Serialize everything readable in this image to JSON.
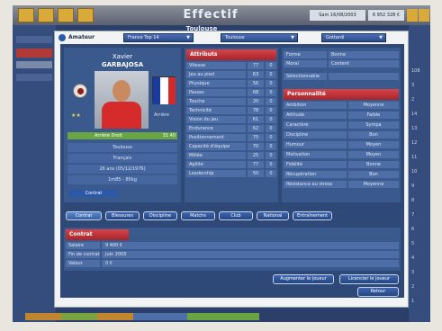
{
  "screen": {
    "title": "Effectif",
    "team_subtitle": "Toulouse",
    "date": "Sam 16/08/2003",
    "money": "6 952 328 €"
  },
  "dialog_header": {
    "logo": "Amateur",
    "filter_1": "France Top 14",
    "filter_2": "Toulouse",
    "filter_3": "Gottardi"
  },
  "player": {
    "first_name": "Xavier",
    "last_name": "GARBAJOSA",
    "stars": "★★",
    "side": "Arrière",
    "position": "Arrière Droit",
    "position_value": "31",
    "position_delta": "40",
    "info": [
      "Toulouse",
      "Français",
      "26 ans (05/12/1976)",
      "1m85 - 85kg"
    ],
    "contract_button": "Contrat"
  },
  "attributes": {
    "title": "Attributs",
    "rows": [
      {
        "label": "Vitesse",
        "value": "77",
        "delta": "0"
      },
      {
        "label": "Jeu au pied",
        "value": "63",
        "delta": "0"
      },
      {
        "label": "Physique",
        "value": "56",
        "delta": "0"
      },
      {
        "label": "Passes",
        "value": "68",
        "delta": "0"
      },
      {
        "label": "Touche",
        "value": "20",
        "delta": "0"
      },
      {
        "label": "Technicité",
        "value": "78",
        "delta": "0"
      },
      {
        "label": "Vision du jeu",
        "value": "61",
        "delta": "0"
      },
      {
        "label": "Endurance",
        "value": "62",
        "delta": "0"
      },
      {
        "label": "Positionnement",
        "value": "75",
        "delta": "0"
      },
      {
        "label": "Capacité d'équipe",
        "value": "70",
        "delta": "0"
      },
      {
        "label": "Mêlée",
        "value": "25",
        "delta": "0"
      },
      {
        "label": "Agilité",
        "value": "77",
        "delta": "0"
      },
      {
        "label": "Leadership",
        "value": "50",
        "delta": "0"
      }
    ]
  },
  "status": {
    "rows": [
      {
        "key": "Forme",
        "value": "Bonne"
      },
      {
        "key": "Moral",
        "value": "Content"
      }
    ],
    "extra": "Sélectionnable"
  },
  "personality": {
    "title": "Personnalité",
    "rows": [
      {
        "key": "Ambition",
        "value": "Moyenne"
      },
      {
        "key": "Attitude",
        "value": "Faible"
      },
      {
        "key": "Caractère",
        "value": "Sympa"
      },
      {
        "key": "Discipline",
        "value": "Bon"
      },
      {
        "key": "Humour",
        "value": "Moyen"
      },
      {
        "key": "Motivation",
        "value": "Moyen"
      },
      {
        "key": "Fidélité",
        "value": "Bonne"
      },
      {
        "key": "Récupération",
        "value": "Bon"
      },
      {
        "key": "Résistance au stress",
        "value": "Moyenne"
      }
    ]
  },
  "tabs": [
    {
      "label": "Contrat",
      "active": true
    },
    {
      "label": "Blessures"
    },
    {
      "label": "Discipline"
    },
    {
      "label": "Matchs"
    },
    {
      "label": "Club"
    },
    {
      "label": "National"
    },
    {
      "label": "Entraînement"
    }
  ],
  "contract": {
    "title": "Contrat",
    "rows": [
      {
        "key": "Salaire",
        "value": "9 400 €"
      },
      {
        "key": "Fin de contrat",
        "value": "Juin 2005"
      },
      {
        "key": "Valeur",
        "value": "0 €"
      }
    ]
  },
  "actions": {
    "raise_salary": "Augmenter le joueur",
    "release": "Licencier le joueur",
    "back": "Retour"
  },
  "ghost_numbers": [
    "108",
    "3",
    "2",
    "14",
    "13",
    "12",
    "11",
    "10",
    "9",
    "8",
    "7",
    "6",
    "5",
    "4",
    "3",
    "2",
    "1"
  ],
  "colors": {
    "accent_red": "#c33238",
    "panel_blue": "#3a5a8e",
    "position_green": "#6aa544"
  }
}
